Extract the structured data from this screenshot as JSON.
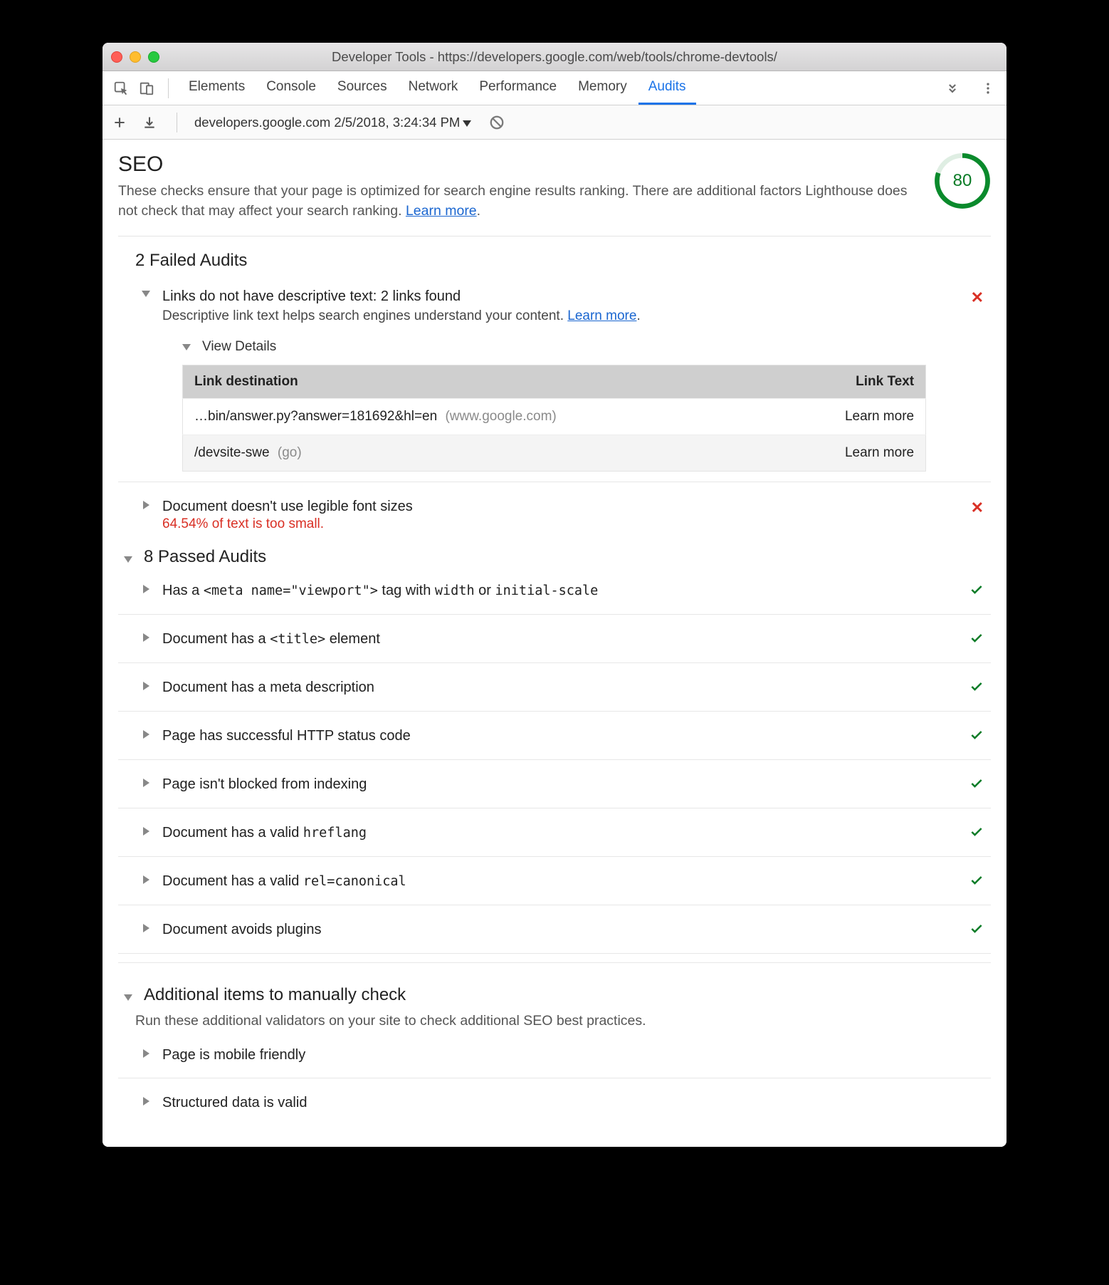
{
  "window": {
    "title": "Developer Tools - https://developers.google.com/web/tools/chrome-devtools/"
  },
  "devtoolsTabs": {
    "items": [
      "Elements",
      "Console",
      "Sources",
      "Network",
      "Performance",
      "Memory",
      "Audits"
    ],
    "active": "Audits"
  },
  "toolbar": {
    "runLabel": "developers.google.com 2/5/2018, 3:24:34 PM"
  },
  "seo": {
    "title": "SEO",
    "desc_lead": "These checks ensure that your page is optimized for search engine results ranking. There are additional factors Lighthouse does not check that may affect your search ranking. ",
    "learn_more": "Learn more",
    "score": "80"
  },
  "failed": {
    "heading": "2 Failed Audits",
    "audit1": {
      "title": "Links do not have descriptive text: 2 links found",
      "sub_lead": "Descriptive link text helps search engines understand your content. ",
      "learn_more": "Learn more",
      "view_details": "View Details",
      "col_dest": "Link destination",
      "col_text": "Link Text",
      "rows": [
        {
          "path": "…bin/answer.py?answer=181692&hl=en",
          "host": "(www.google.com)",
          "text": "Learn more"
        },
        {
          "path": "/devsite-swe",
          "host": "(go)",
          "text": "Learn more"
        }
      ]
    },
    "audit2": {
      "title": "Document doesn't use legible font sizes",
      "note": "64.54% of text is too small."
    }
  },
  "passed": {
    "heading": "8 Passed Audits",
    "items": [
      {
        "pre": "Has a ",
        "code": "<meta name=\"viewport\">",
        "mid": " tag with ",
        "code2": "width",
        "mid2": " or ",
        "code3": "initial-scale"
      },
      {
        "pre": "Document has a ",
        "code": "<title>",
        "post": " element"
      },
      {
        "plain": "Document has a meta description"
      },
      {
        "plain": "Page has successful HTTP status code"
      },
      {
        "plain": "Page isn't blocked from indexing"
      },
      {
        "pre": "Document has a valid ",
        "code": "hreflang"
      },
      {
        "pre": "Document has a valid ",
        "code": "rel=canonical"
      },
      {
        "plain": "Document avoids plugins"
      }
    ]
  },
  "manual": {
    "heading": "Additional items to manually check",
    "sub": "Run these additional validators on your site to check additional SEO best practices.",
    "items": [
      "Page is mobile friendly",
      "Structured data is valid"
    ]
  }
}
